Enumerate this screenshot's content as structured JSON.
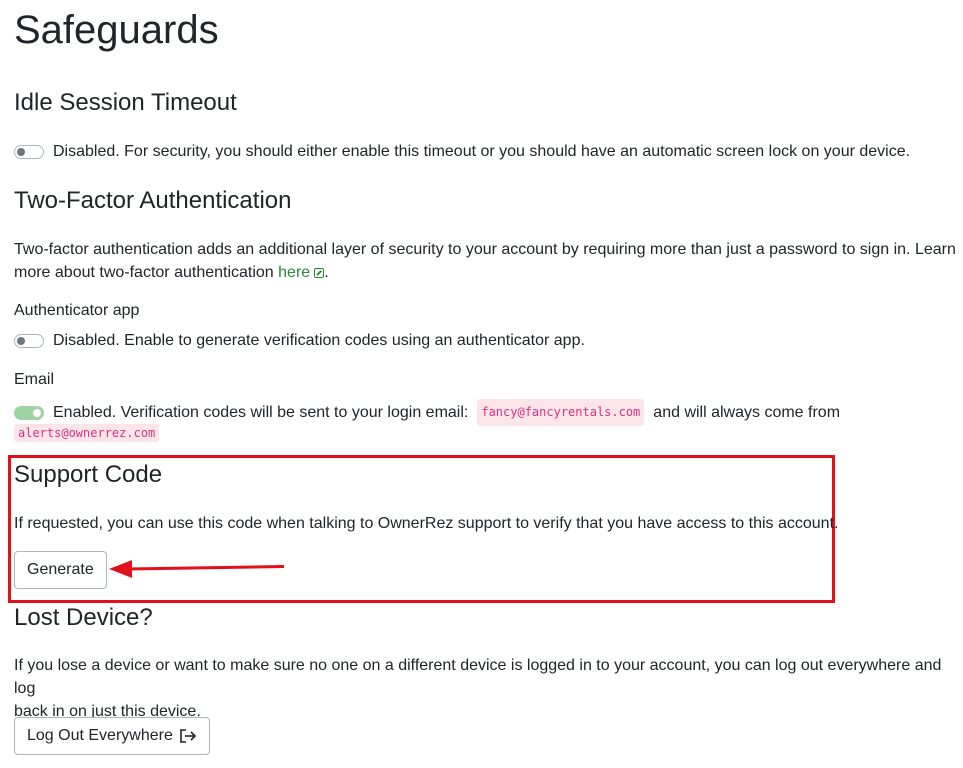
{
  "page_title": "Safeguards",
  "idle": {
    "title": "Idle Session Timeout",
    "status_text": "Disabled. For security, you should either enable this timeout or you should have an automatic screen lock on your device."
  },
  "tfa": {
    "title": "Two-Factor Authentication",
    "description_line1": "Two-factor authentication adds an additional layer of security to your account by requiring more than just a password to sign in. Learn",
    "description_line2": "more about two-factor authentication ",
    "link_text": "here",
    "after_link": ".",
    "authenticator_label": "Authenticator app",
    "authenticator_status": "Disabled. Enable to generate verification codes using an authenticator app.",
    "email_label": "Email",
    "email_status_prefix": "Enabled. Verification codes will be sent to your login email:",
    "login_email": "fancy@fancyrentals.com",
    "email_status_middle": "and will always come from",
    "from_email": "alerts@ownerrez.com"
  },
  "support": {
    "title": "Support Code",
    "description": "If requested, you can use this code when talking to OwnerRez support to verify that you have access to this account.",
    "generate_label": "Generate"
  },
  "lost": {
    "title": "Lost Device?",
    "description_line1": "If you lose a device or want to make sure no one on a different device is logged in to your account, you can log out everywhere and log",
    "description_line2": "back in on just this device.",
    "logout_label": "Log Out Everywhere"
  },
  "colors": {
    "annotation_red": "#e0111a",
    "link_green": "#2a8a3c",
    "toggle_on": "#9fd3a4",
    "code_pink": "#d63384"
  },
  "icons": {
    "external_link": "external-link-icon",
    "logout": "sign-out-icon",
    "annotation_arrow": "arrow-left-icon"
  }
}
